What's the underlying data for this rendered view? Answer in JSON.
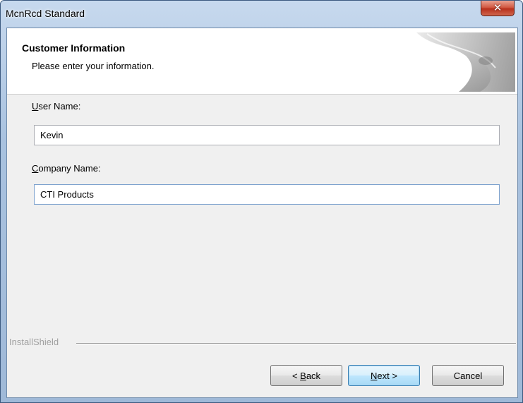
{
  "window": {
    "title": "McnRcd Standard",
    "close_glyph": "✕"
  },
  "header": {
    "title": "Customer Information",
    "subtitle": "Please enter your information."
  },
  "fields": {
    "user_name": {
      "label_mnemonic": "U",
      "label_rest": "ser Name:",
      "value": "Kevin"
    },
    "company_name": {
      "label_mnemonic": "C",
      "label_rest": "ompany Name:",
      "value": "CTI Products"
    }
  },
  "branding": {
    "text": "InstallShield"
  },
  "buttons": {
    "back": {
      "prefix": "< ",
      "mnemonic": "B",
      "rest": "ack"
    },
    "next": {
      "prefix": "",
      "mnemonic": "N",
      "rest": "ext >"
    },
    "cancel": {
      "label": "Cancel"
    }
  },
  "colors": {
    "title_bar": "#a9c2df",
    "dialog_background": "#f0f0f0",
    "close_button": "#c8432b",
    "default_button_border": "#3c7fb1"
  },
  "icons": {
    "close": "close-icon",
    "header_art": "page-curl-graphic"
  }
}
